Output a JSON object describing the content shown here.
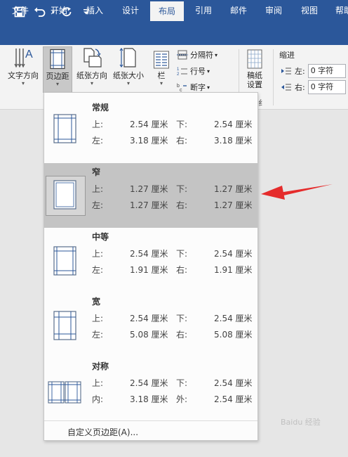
{
  "colors": {
    "brand": "#2b579a",
    "selected_bg": "#c4c4c4",
    "arrow": "#e52c2c"
  },
  "qat": {
    "icons": [
      "save-icon",
      "undo-icon",
      "redo-icon",
      "customize-icon"
    ]
  },
  "tabs": [
    "文件",
    "开始",
    "插入",
    "设计",
    "布局",
    "引用",
    "邮件",
    "审阅",
    "视图",
    "帮助"
  ],
  "active_tab": "布局",
  "ribbon": {
    "text_direction": "文字方向",
    "margins": "页边距",
    "orientation": "纸张方向",
    "size": "纸张大小",
    "columns": "栏",
    "breaks": "分隔符",
    "line_numbers": "行号",
    "hyphenation": "断字",
    "manuscript_1": "稿纸",
    "manuscript_2": "设置",
    "indent_group": "缩进",
    "indent_left_label": "左:",
    "indent_left_value": "0 字符",
    "indent_right_label": "右:",
    "indent_right_value": "0 字符",
    "group_fragment": "纟"
  },
  "margins_menu": {
    "options": [
      {
        "name": "常规",
        "l1": "上:",
        "v1": "2.54 厘米",
        "l2": "下:",
        "v2": "2.54 厘米",
        "l3": "左:",
        "v3": "3.18 厘米",
        "l4": "右:",
        "v4": "3.18 厘米"
      },
      {
        "name": "窄",
        "l1": "上:",
        "v1": "1.27 厘米",
        "l2": "下:",
        "v2": "1.27 厘米",
        "l3": "左:",
        "v3": "1.27 厘米",
        "l4": "右:",
        "v4": "1.27 厘米"
      },
      {
        "name": "中等",
        "l1": "上:",
        "v1": "2.54 厘米",
        "l2": "下:",
        "v2": "2.54 厘米",
        "l3": "左:",
        "v3": "1.91 厘米",
        "l4": "右:",
        "v4": "1.91 厘米"
      },
      {
        "name": "宽",
        "l1": "上:",
        "v1": "2.54 厘米",
        "l2": "下:",
        "v2": "2.54 厘米",
        "l3": "左:",
        "v3": "5.08 厘米",
        "l4": "右:",
        "v4": "5.08 厘米"
      },
      {
        "name": "对称",
        "l1": "上:",
        "v1": "2.54 厘米",
        "l2": "下:",
        "v2": "2.54 厘米",
        "l3": "内:",
        "v3": "3.18 厘米",
        "l4": "外:",
        "v4": "2.54 厘米"
      }
    ],
    "selected": "窄",
    "custom": "自定义页边距(A)..."
  },
  "watermark": "Baidu 经验"
}
